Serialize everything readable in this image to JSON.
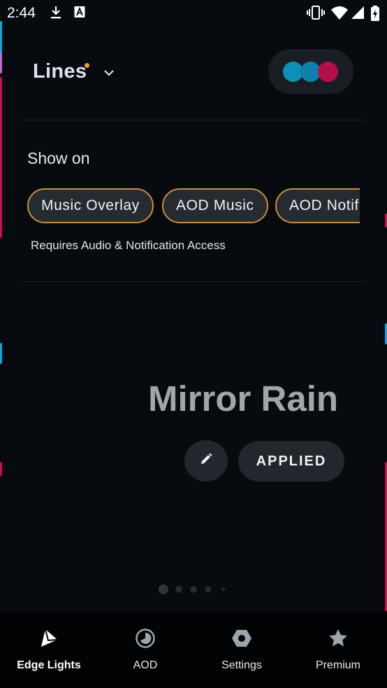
{
  "status_bar": {
    "time": "2:44",
    "icons": [
      "download-icon",
      "a-letter-icon",
      "vibrate-icon",
      "wifi-icon",
      "signal-icon",
      "battery-charging-icon"
    ]
  },
  "header": {
    "title": "Lines",
    "badge_color": "#e2a03a",
    "dropdown_icon": "chevron-down-icon",
    "color_dots": [
      "#0d90b8",
      "#117fae",
      "#b3104a"
    ]
  },
  "show_on": {
    "label": "Show on",
    "chips": [
      "Music Overlay",
      "AOD Music",
      "AOD Notifi"
    ],
    "requirement": "Requires Audio & Notification Access"
  },
  "preview": {
    "name": "Mirror Rain",
    "edit_icon": "pencil-icon",
    "applied_label": "APPLIED"
  },
  "pager": {
    "pages": 5,
    "current": 1
  },
  "bottom_nav": {
    "items": [
      {
        "label": "Edge Lights",
        "icon": "edge-lights-icon",
        "active": true
      },
      {
        "label": "AOD",
        "icon": "aod-clock-icon",
        "active": false
      },
      {
        "label": "Settings",
        "icon": "settings-hexagon-icon",
        "active": false
      },
      {
        "label": "Premium",
        "icon": "star-icon",
        "active": false
      }
    ]
  },
  "colors": {
    "background": "#070b10",
    "chip_border": "#c98f3d",
    "edge_blue": "#1aa3d9",
    "edge_pink": "#d11452"
  }
}
